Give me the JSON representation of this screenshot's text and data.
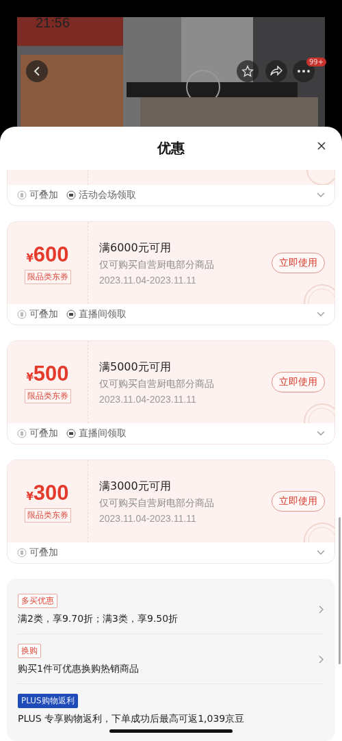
{
  "status_bar": {
    "time": "21:56"
  },
  "product_header": {
    "badge": "99+"
  },
  "sheet": {
    "title": "优惠"
  },
  "coupons": [
    {
      "kind": "cut",
      "tags": [
        {
          "kind": "stack",
          "label": "可叠加"
        },
        {
          "kind": "source",
          "label": "活动会场领取"
        }
      ]
    },
    {
      "kind": "full",
      "currency": "¥",
      "amount": "600",
      "type_tag": "限品类东券",
      "title": "满6000元可用",
      "scope": "仅可购买自营厨电部分商品",
      "dates": "2023.11.04-2023.11.11",
      "action": "立即使用",
      "tags": [
        {
          "kind": "stack",
          "label": "可叠加"
        },
        {
          "kind": "source",
          "label": "直播间领取"
        }
      ]
    },
    {
      "kind": "full",
      "currency": "¥",
      "amount": "500",
      "type_tag": "限品类东券",
      "title": "满5000元可用",
      "scope": "仅可购买自营厨电部分商品",
      "dates": "2023.11.04-2023.11.11",
      "action": "立即使用",
      "tags": [
        {
          "kind": "stack",
          "label": "可叠加"
        },
        {
          "kind": "source",
          "label": "直播间领取"
        }
      ]
    },
    {
      "kind": "full",
      "currency": "¥",
      "amount": "300",
      "type_tag": "限品类东券",
      "title": "满3000元可用",
      "scope": "仅可购买自营厨电部分商品",
      "dates": "2023.11.04-2023.11.11",
      "action": "立即使用",
      "tags": [
        {
          "kind": "stack",
          "label": "可叠加"
        }
      ]
    }
  ],
  "promotions": [
    {
      "kind": "outline",
      "tag": "多买优惠",
      "text": "满2类，享9.70折；满3类，享9.50折",
      "arrow": true
    },
    {
      "kind": "outline",
      "tag": "换购",
      "text": "购买1件可优惠换购热销商品",
      "arrow": true
    },
    {
      "kind": "solid",
      "tag": "PLUS购物返利",
      "text": "PLUS 专享购物返利，下单成功后最高可返1,039京豆",
      "arrow": false
    }
  ]
}
